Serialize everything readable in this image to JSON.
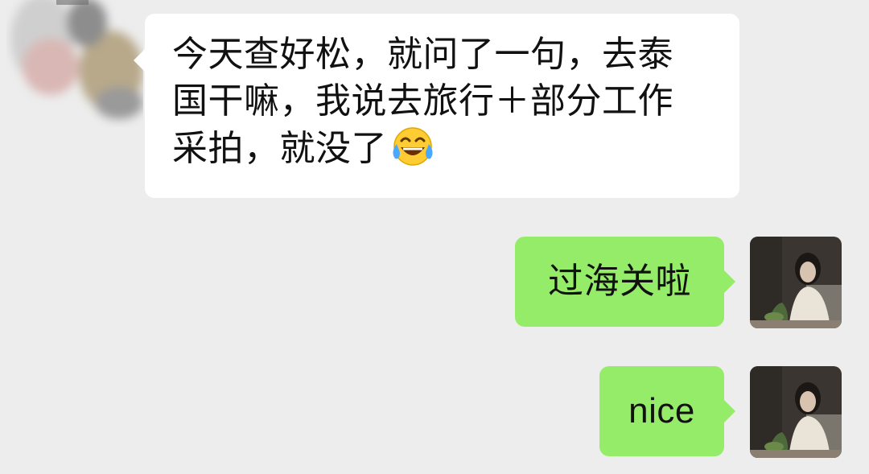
{
  "chat": {
    "messages": [
      {
        "direction": "incoming",
        "text_lines": [
          "今天查好松，就问了一句，去泰",
          "国干嘛，我说去旅行＋部分工作",
          "采拍，就没了"
        ],
        "emoji": "face-with-tears-of-joy-icon"
      },
      {
        "direction": "outgoing",
        "text": "过海关啦"
      },
      {
        "direction": "outgoing",
        "text": "nice"
      }
    ]
  },
  "colors": {
    "background": "#ededed",
    "incoming_bubble": "#ffffff",
    "outgoing_bubble": "#95ec69",
    "text": "#111111"
  }
}
